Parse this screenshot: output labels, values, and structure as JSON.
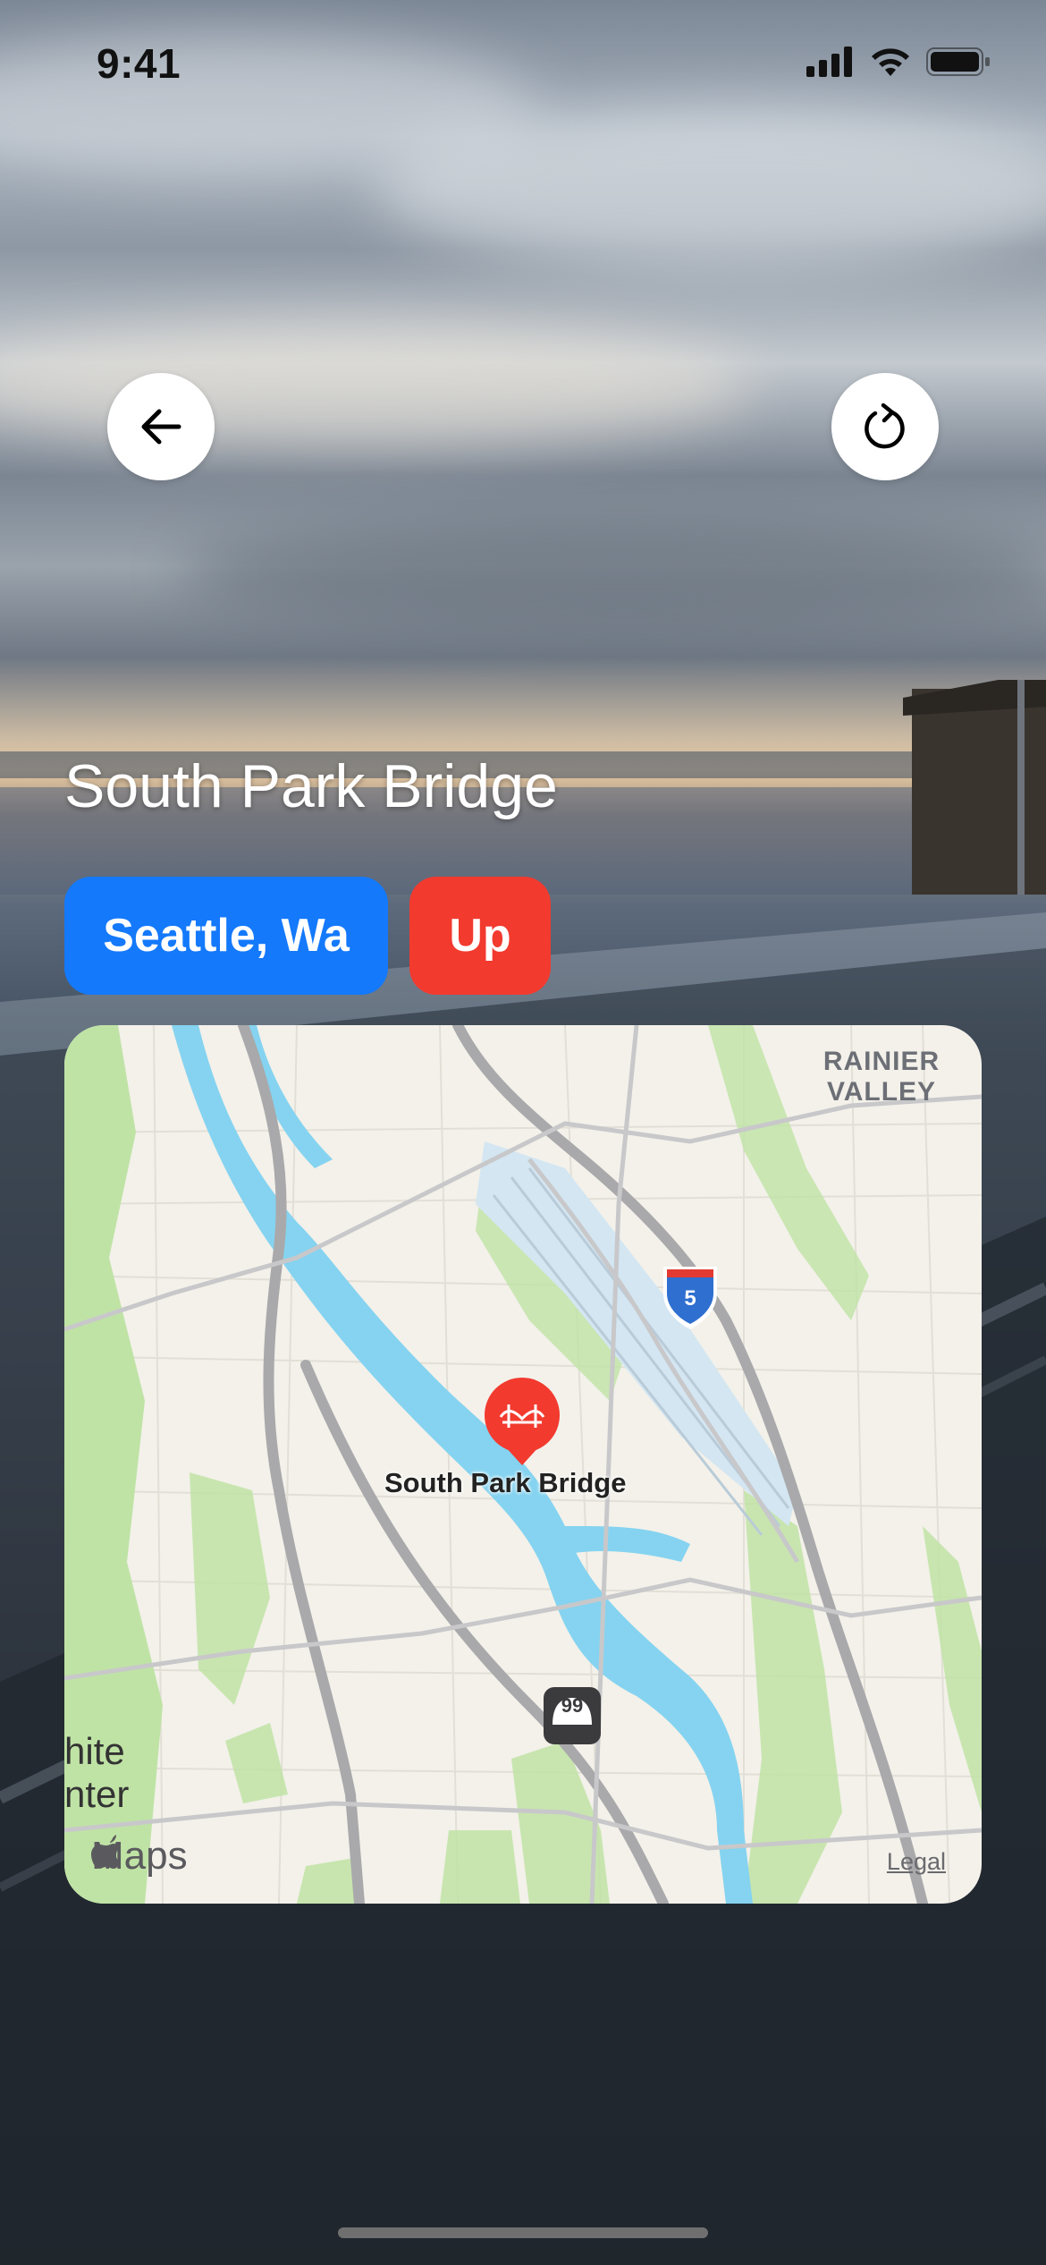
{
  "status_bar": {
    "time": "9:41"
  },
  "header": {
    "back_icon": "arrow-left-icon",
    "refresh_icon": "refresh-icon"
  },
  "bridge": {
    "name": "South Park Bridge",
    "location_label": "Seattle, Wa",
    "status_label": "Up",
    "location_color": "#1479fb",
    "status_color": "#f23a2f"
  },
  "map": {
    "pin_label": "South Park Bridge",
    "area_label_line1": "RAINIER",
    "area_label_line2": "VALLEY",
    "highway_i5": "5",
    "highway_99": "99",
    "partial_label_line1": "hite",
    "partial_label_line2": "nter",
    "brand": "Maps",
    "legal": "Legal"
  }
}
